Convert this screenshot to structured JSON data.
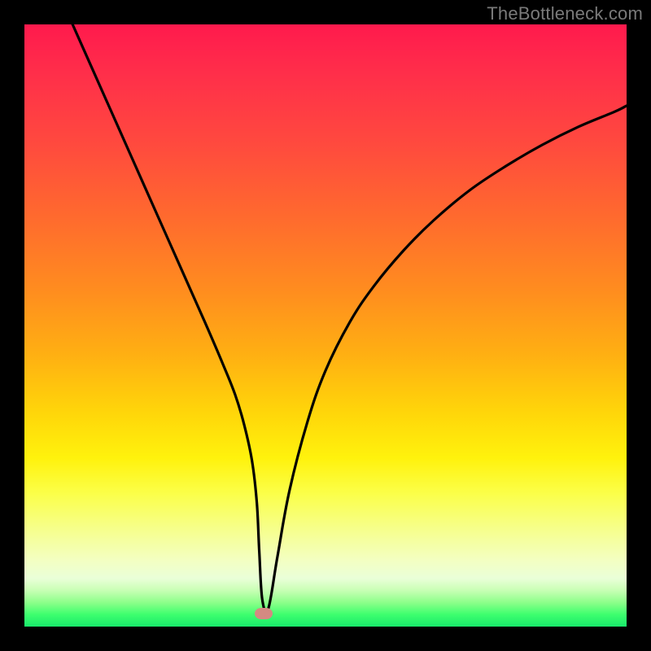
{
  "attribution": "TheBottleneck.com",
  "chart_data": {
    "type": "line",
    "title": "",
    "xlabel": "",
    "ylabel": "",
    "xlim": [
      0,
      100
    ],
    "ylim": [
      0,
      100
    ],
    "series": [
      {
        "name": "curve",
        "x": [
          8,
          10,
          14,
          18,
          22,
          26,
          30,
          33,
          35,
          36.5,
          37.8,
          38.6,
          39,
          39.5,
          40.5,
          42,
          44,
          47,
          50,
          54,
          58,
          63,
          68,
          74,
          80,
          86,
          92,
          98,
          100
        ],
        "y": [
          100,
          95.5,
          86.5,
          77.5,
          68.5,
          59.5,
          50.5,
          43.5,
          38.5,
          33.5,
          27.5,
          20.5,
          12.5,
          4.5,
          3.0,
          11.5,
          22.5,
          34.0,
          42.5,
          50.5,
          56.5,
          62.5,
          67.5,
          72.5,
          76.5,
          80.0,
          83.0,
          85.5,
          86.5
        ]
      }
    ],
    "marker": {
      "x": 39.7,
      "y": 2.2
    },
    "background_gradient": {
      "top": "#ff1a4d",
      "middle": "#ffd40a",
      "bottom": "#18e96b"
    }
  }
}
